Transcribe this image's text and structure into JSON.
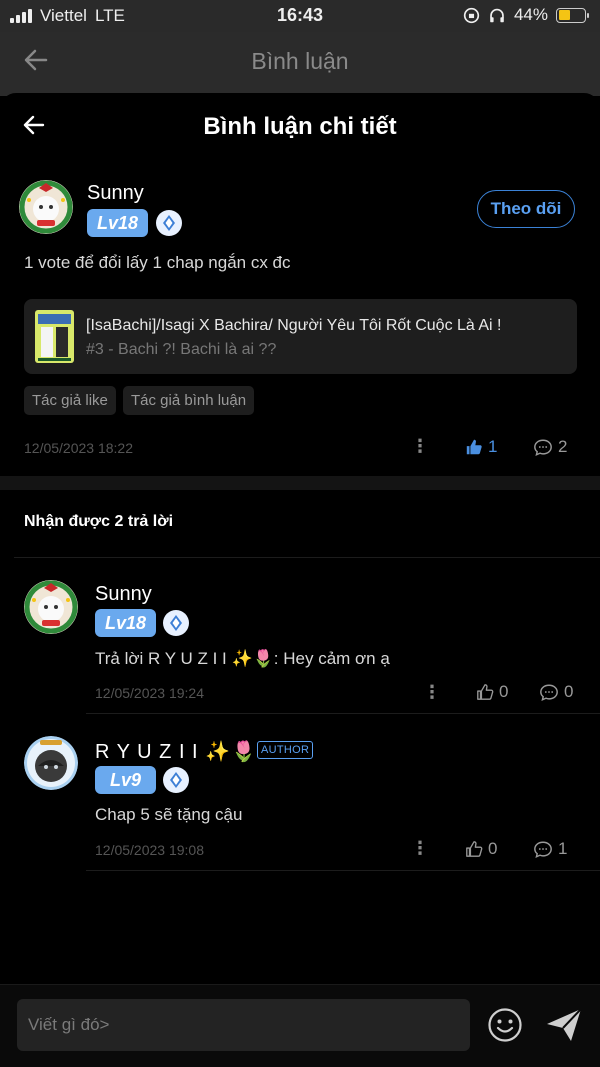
{
  "status_bar": {
    "carrier": "Viettel",
    "network": "LTE",
    "time": "16:43",
    "battery": "44%",
    "battery_level": 0.44
  },
  "background_header": {
    "title": "Bình luận"
  },
  "sheet": {
    "title": "Bình luận chi tiết"
  },
  "comment": {
    "user": "Sunny",
    "level": "Lv18",
    "follow_label": "Theo dõi",
    "text": "1 vote để đổi lấy 1 chap ngắn cx đc",
    "story": {
      "title": "[IsaBachi]/Isagi X Bachira/ Người Yêu Tôi Rốt Cuộc Là Ai !",
      "chapter": "#3 - Bachi ?! Bachi là ai ??"
    },
    "tags": [
      "Tác giả like",
      "Tác giả bình luận"
    ],
    "date": "12/05/2023 18:22",
    "likes": "1",
    "replies": "2"
  },
  "replies_header": "Nhận được 2 trả lời",
  "replies": [
    {
      "user": "Sunny",
      "level": "Lv18",
      "text": "Trả lời R Y U Z I I ✨🌷: Hey cảm ơn ạ",
      "date": "12/05/2023 19:24",
      "likes": "0",
      "replies": "0"
    },
    {
      "user": "R Y U Z I I ✨🌷",
      "author_tag": "AUTHOR",
      "level": "Lv9",
      "text": "Chap 5 sẽ tặng cậu",
      "date": "12/05/2023 19:08",
      "likes": "0",
      "replies": "1"
    }
  ],
  "composer": {
    "placeholder": "Viết gì đó>"
  },
  "colors": {
    "accent": "#4a8fe0",
    "level_badge": "#6aa9ee",
    "battery": "#f4c414"
  },
  "icons": [
    "back-arrow-icon",
    "thumb-up-icon",
    "comment-bubble-icon",
    "more-dots-icon",
    "emoji-icon",
    "send-icon",
    "gem-icon"
  ]
}
